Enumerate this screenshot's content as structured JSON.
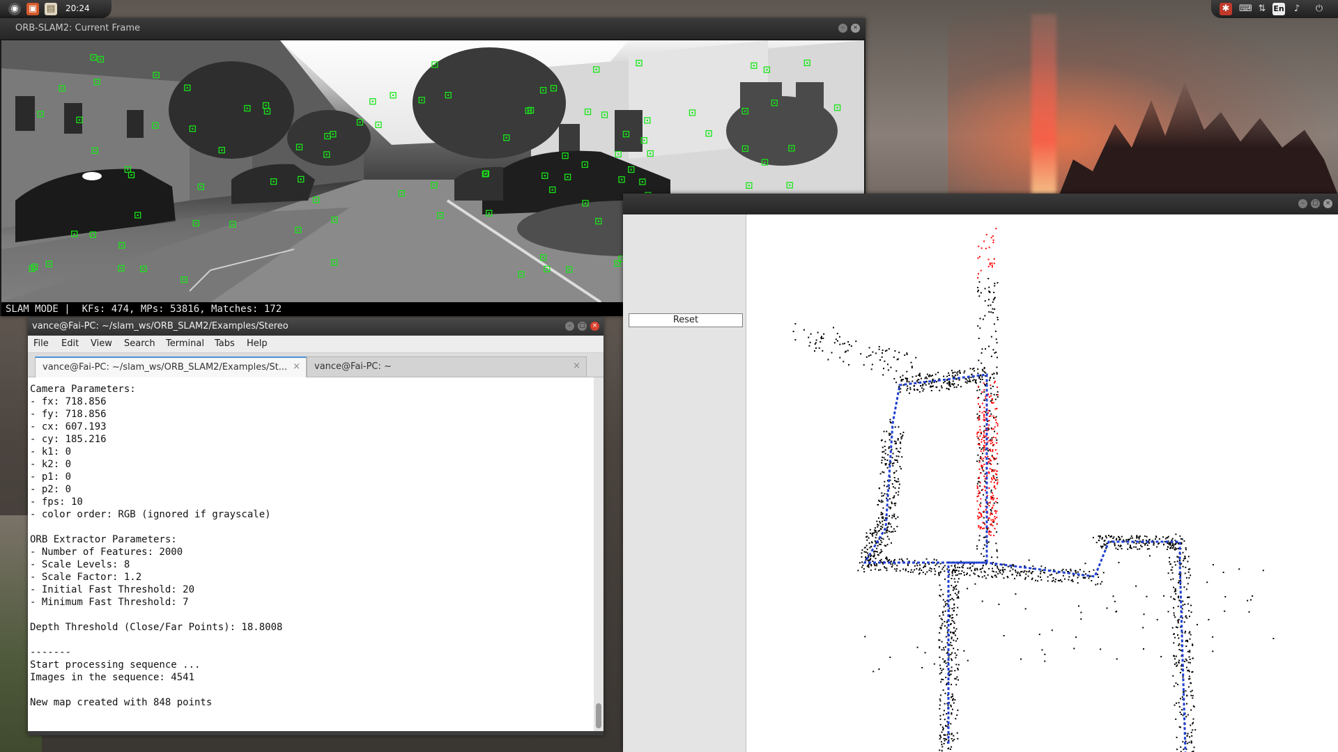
{
  "top_panel": {
    "clock": "20:24",
    "left_icons": [
      "ubuntu-logo-icon",
      "files-icon",
      "folder-icon"
    ],
    "right_icons": [
      "settings-icon",
      "keyboard-icon",
      "network-icon",
      "language-indicator",
      "volume-icon",
      "power-icon"
    ],
    "language": "En"
  },
  "camera_window": {
    "title": "ORB-SLAM2: Current Frame",
    "status": "SLAM MODE |  KFs: 474, MPs: 53816, Matches: 172",
    "feature_color": "#19e619"
  },
  "terminal": {
    "title": "vance@Fai-PC: ~/slam_ws/ORB_SLAM2/Examples/Stereo",
    "menu": [
      "File",
      "Edit",
      "View",
      "Search",
      "Terminal",
      "Tabs",
      "Help"
    ],
    "tabs": [
      {
        "label": "vance@Fai-PC: ~/slam_ws/ORB_SLAM2/Examples/St...",
        "active": true
      },
      {
        "label": "vance@Fai-PC: ~",
        "active": false
      }
    ],
    "output": "Camera Parameters:\n- fx: 718.856\n- fy: 718.856\n- cx: 607.193\n- cy: 185.216\n- k1: 0\n- k2: 0\n- p1: 0\n- p2: 0\n- fps: 10\n- color order: RGB (ignored if grayscale)\n\nORB Extractor Parameters:\n- Number of Features: 2000\n- Scale Levels: 8\n- Scale Factor: 1.2\n- Initial Fast Threshold: 20\n- Minimum Fast Threshold: 7\n\nDepth Threshold (Close/Far Points): 18.8008\n\n-------\nStart processing sequence ...\nImages in the sequence: 4541\n\nNew map created with 848 points"
  },
  "map_viewer": {
    "reset_label": "Reset",
    "trajectory_color": "#1f3fd0",
    "local_points_color": "#ff0000",
    "map_points_color": "#000000"
  }
}
